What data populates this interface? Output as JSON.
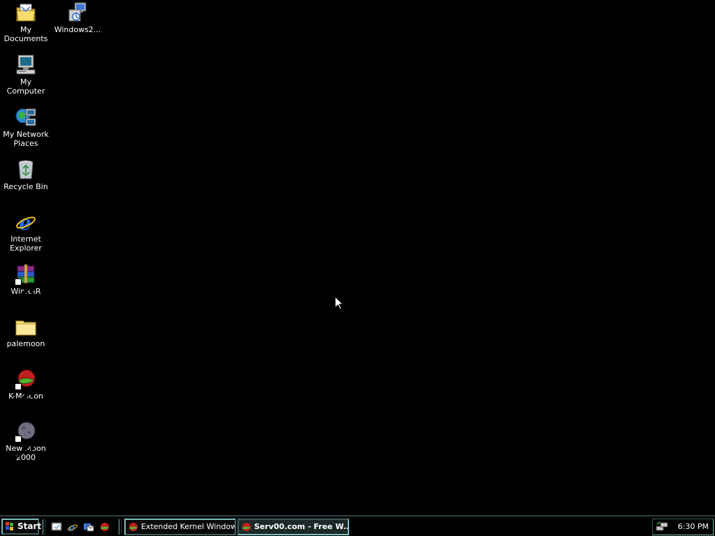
{
  "desktop": {
    "background_color": "#000000",
    "icons": [
      {
        "label": "My Documents",
        "icon": "my-documents-folder-icon"
      },
      {
        "label": "Windows2...",
        "icon": "windows-update-icon"
      },
      {
        "label": "My Computer",
        "icon": "my-computer-icon"
      },
      {
        "label": "My Network Places",
        "icon": "network-places-icon"
      },
      {
        "label": "Recycle Bin",
        "icon": "recycle-bin-icon"
      },
      {
        "label": "Internet Explorer",
        "icon": "internet-explorer-icon"
      },
      {
        "label": "WinRAR",
        "icon": "winrar-icon"
      },
      {
        "label": "palemoon",
        "icon": "folder-icon"
      },
      {
        "label": "K-Meleon",
        "icon": "k-meleon-icon"
      },
      {
        "label": "New Moon 2000",
        "icon": "new-moon-icon"
      }
    ]
  },
  "taskbar": {
    "start_label": "Start",
    "quick_launch": [
      "show-desktop-icon",
      "internet-explorer-icon",
      "outlook-express-icon",
      "k-meleon-icon"
    ],
    "tasks": [
      {
        "label": "Extended Kernel Windows...",
        "active": false
      },
      {
        "label": "Serv00.com - Free W...",
        "active": true
      }
    ],
    "tray": {
      "clock": "6:30 PM",
      "icons": [
        "network-connection-icon"
      ]
    }
  }
}
